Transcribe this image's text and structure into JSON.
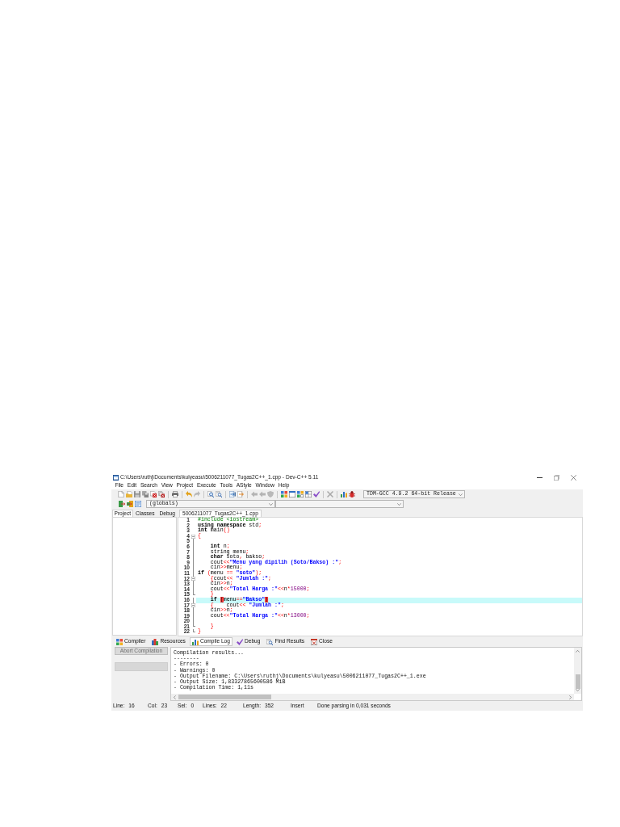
{
  "window": {
    "title": "C:\\Users\\ruthj\\Documents\\kulyeasu\\5006211077_Tugas2C++_1.cpp - Dev-C++ 5.11"
  },
  "menu": [
    "File",
    "Edit",
    "Search",
    "View",
    "Project",
    "Execute",
    "Tools",
    "AStyle",
    "Window",
    "Help"
  ],
  "toolbar": {
    "compiler": "TDM-GCC 4.9.2 64-bit Release",
    "scope": "(globals)"
  },
  "side_panel": {
    "tabs": [
      {
        "label": "Project",
        "selected": true
      },
      {
        "label": "Classes",
        "selected": false
      },
      {
        "label": "Debug",
        "selected": false
      }
    ]
  },
  "editor": {
    "tabs": [
      {
        "label": "5006211077_Tugas2C++_1.cpp",
        "selected": true
      }
    ],
    "lines": [
      {
        "number": "1",
        "current": false,
        "kind": "plain",
        "tokens": [
          {
            "kind": "preprocessor",
            "text": "#include <iostream>"
          }
        ]
      },
      {
        "number": "2",
        "current": false,
        "kind": "plain",
        "tokens": [
          {
            "kind": "keyword",
            "text": "using namespace"
          },
          {
            "kind": "plain",
            "text": " std"
          },
          {
            "kind": "symbol",
            "text": ";"
          }
        ]
      },
      {
        "number": "3",
        "current": false,
        "kind": "plain",
        "tokens": [
          {
            "kind": "keyword",
            "text": "int"
          },
          {
            "kind": "plain",
            "text": " main"
          },
          {
            "kind": "symbol",
            "text": "()"
          }
        ]
      },
      {
        "number": "4",
        "current": false,
        "kind": "start",
        "tokens": [
          {
            "kind": "symbol",
            "text": "{"
          }
        ]
      },
      {
        "number": "5",
        "current": false,
        "kind": "middle"
      },
      {
        "number": "6",
        "current": false,
        "kind": "middle",
        "tokens": [
          {
            "kind": "keyword",
            "text": "    int"
          },
          {
            "kind": "plain",
            "text": " n"
          },
          {
            "kind": "symbol",
            "text": ";"
          }
        ]
      },
      {
        "number": "7",
        "current": false,
        "kind": "middle",
        "tokens": [
          {
            "kind": "plain",
            "text": "    string menu"
          },
          {
            "kind": "symbol",
            "text": ";"
          }
        ]
      },
      {
        "number": "8",
        "current": false,
        "kind": "middle",
        "tokens": [
          {
            "kind": "keyword",
            "text": "    char"
          },
          {
            "kind": "plain",
            "text": " soto"
          },
          {
            "kind": "symbol",
            "text": ","
          },
          {
            "kind": "plain",
            "text": " bakso"
          },
          {
            "kind": "symbol",
            "text": ";"
          }
        ]
      },
      {
        "number": "9",
        "current": false,
        "kind": "middle",
        "tokens": [
          {
            "kind": "plain",
            "text": "    cout"
          },
          {
            "kind": "symbol",
            "text": "<<"
          },
          {
            "kind": "string",
            "text": "\"Menu yang dipilih (Soto/Bakso) :\""
          },
          {
            "kind": "symbol",
            "text": ";"
          }
        ]
      },
      {
        "number": "10",
        "current": false,
        "kind": "middle",
        "tokens": [
          {
            "kind": "plain",
            "text": "    cin"
          },
          {
            "kind": "symbol",
            "text": ">>"
          },
          {
            "kind": "plain",
            "text": "menu"
          },
          {
            "kind": "symbol",
            "text": ";"
          }
        ]
      },
      {
        "number": "11",
        "current": false,
        "kind": "middle",
        "tokens": [
          {
            "kind": "keyword",
            "text": "if "
          },
          {
            "kind": "symbol",
            "text": "("
          },
          {
            "kind": "plain",
            "text": "menu "
          },
          {
            "kind": "symbol",
            "text": "== "
          },
          {
            "kind": "string",
            "text": "\"soto\""
          },
          {
            "kind": "symbol",
            "text": ");"
          }
        ]
      },
      {
        "number": "12",
        "current": false,
        "kind": "start",
        "tokens": [
          {
            "kind": "symbol",
            "text": "    {"
          },
          {
            "kind": "plain",
            "text": "cout"
          },
          {
            "kind": "symbol",
            "text": "<< "
          },
          {
            "kind": "string",
            "text": "\"Jumlah :\""
          },
          {
            "kind": "symbol",
            "text": ";"
          }
        ]
      },
      {
        "number": "13",
        "current": false,
        "kind": "middle",
        "tokens": [
          {
            "kind": "plain",
            "text": "    cin"
          },
          {
            "kind": "symbol",
            "text": ">>"
          },
          {
            "kind": "plain",
            "text": "n"
          },
          {
            "kind": "symbol",
            "text": ";"
          }
        ]
      },
      {
        "number": "14",
        "current": false,
        "kind": "middle",
        "tokens": [
          {
            "kind": "plain",
            "text": "    cout"
          },
          {
            "kind": "symbol",
            "text": "<<"
          },
          {
            "kind": "string",
            "text": "\"Total Harga :\""
          },
          {
            "kind": "symbol",
            "text": "<<"
          },
          {
            "kind": "plain",
            "text": "n"
          },
          {
            "kind": "symbol",
            "text": "*"
          },
          {
            "kind": "number",
            "text": "15000"
          },
          {
            "kind": "symbol",
            "text": ";"
          }
        ]
      },
      {
        "number": "15",
        "current": false,
        "kind": "end",
        "tokens": [
          {
            "kind": "symbol",
            "text": "    }"
          }
        ]
      },
      {
        "number": "16",
        "current": true,
        "kind": "middle",
        "tokens": [
          {
            "kind": "keyword",
            "text": "    if "
          },
          {
            "kind": "match",
            "text": "("
          },
          {
            "kind": "plain",
            "text": "menu"
          },
          {
            "kind": "symbol",
            "text": "=="
          },
          {
            "kind": "string",
            "text": "\"Bakso\""
          },
          {
            "kind": "match",
            "text": ")"
          }
        ]
      },
      {
        "number": "17",
        "current": false,
        "kind": "start",
        "tokens": [
          {
            "kind": "symbol",
            "text": "    {"
          },
          {
            "kind": "plain",
            "text": "    cout"
          },
          {
            "kind": "symbol",
            "text": "<< "
          },
          {
            "kind": "string",
            "text": "\"Jumlah :\""
          },
          {
            "kind": "symbol",
            "text": ";"
          }
        ]
      },
      {
        "number": "18",
        "current": false,
        "kind": "middle",
        "tokens": [
          {
            "kind": "plain",
            "text": "    cin"
          },
          {
            "kind": "symbol",
            "text": ">>"
          },
          {
            "kind": "plain",
            "text": "n"
          },
          {
            "kind": "symbol",
            "text": ";"
          }
        ]
      },
      {
        "number": "19",
        "current": false,
        "kind": "middle",
        "tokens": [
          {
            "kind": "plain",
            "text": "    cout"
          },
          {
            "kind": "symbol",
            "text": "<<"
          },
          {
            "kind": "string",
            "text": "\"Total Harga :\""
          },
          {
            "kind": "symbol",
            "text": "<<"
          },
          {
            "kind": "plain",
            "text": "n"
          },
          {
            "kind": "symbol",
            "text": "*"
          },
          {
            "kind": "number",
            "text": "13000"
          },
          {
            "kind": "symbol",
            "text": ";"
          }
        ]
      },
      {
        "number": "20",
        "current": false,
        "kind": "middle"
      },
      {
        "number": "21",
        "current": false,
        "kind": "end",
        "tokens": [
          {
            "kind": "symbol",
            "text": "    }"
          }
        ]
      },
      {
        "number": "22",
        "current": false,
        "kind": "end",
        "tokens": [
          {
            "kind": "symbol",
            "text": "}"
          }
        ]
      }
    ]
  },
  "bottom_panel": {
    "tabs": [
      {
        "label": "Compiler",
        "selected": false
      },
      {
        "label": "Resources",
        "selected": false
      },
      {
        "label": "Compile Log",
        "selected": true
      },
      {
        "label": "Debug",
        "selected": false
      },
      {
        "label": "Find Results",
        "selected": false
      },
      {
        "label": "Close",
        "selected": false
      }
    ],
    "abort_button": {
      "label": "Abort Compilation",
      "disabled": true
    },
    "log": [
      "Compilation results...",
      "--------",
      "- Errors: 0",
      "- Warnings: 0",
      "- Output Filename: C:\\Users\\ruthj\\Documents\\kulyeasu\\5006211077_Tugas2C++_1.exe",
      "- Output Size: 1,83327865600586 MiB",
      "- Compilation Time: 1,11s"
    ]
  },
  "status_bar": {
    "fields": [
      {
        "label": "Line:",
        "value": "16"
      },
      {
        "label": "Col:",
        "value": "23"
      },
      {
        "label": "Sel:",
        "value": "0"
      },
      {
        "label": "Lines:",
        "value": "22"
      },
      {
        "label": "Length:",
        "value": "352"
      }
    ],
    "mode": "Insert",
    "message": "Done parsing in 0,031 seconds"
  }
}
